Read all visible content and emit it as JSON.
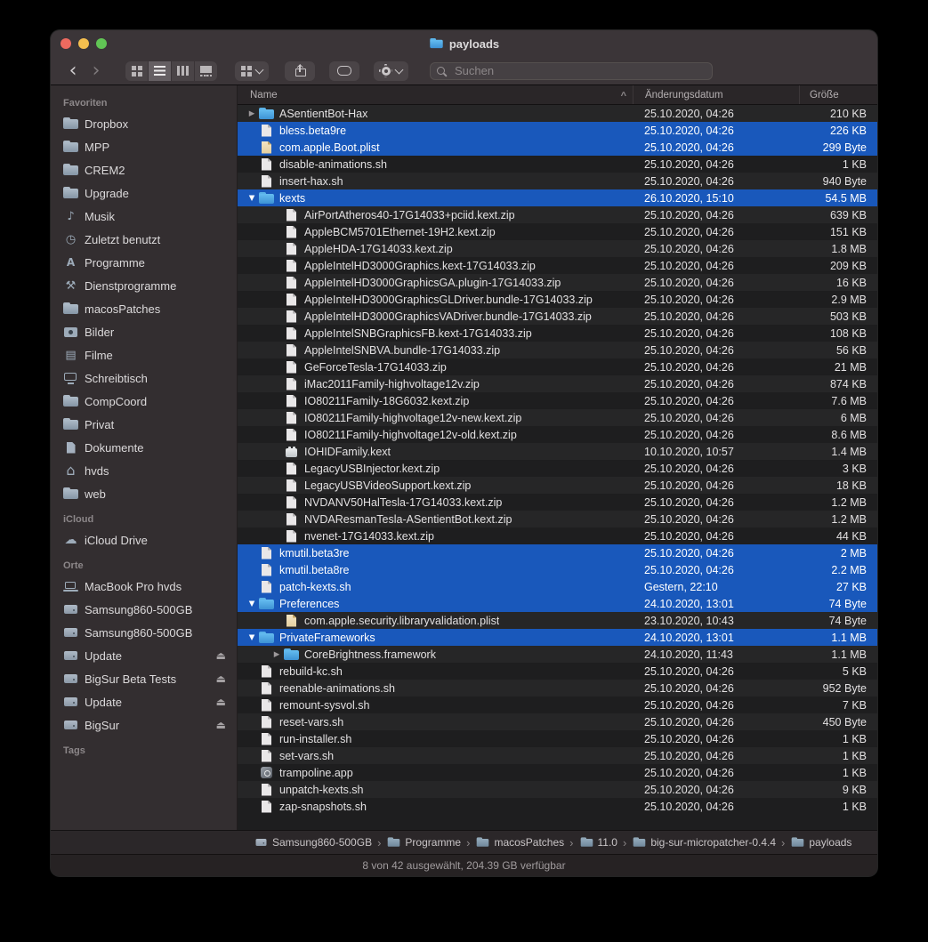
{
  "window": {
    "title": "payloads"
  },
  "toolbar": {
    "search_placeholder": "Suchen"
  },
  "colors": {
    "selection": "#1958bb",
    "traffic_red": "#ed6a5f",
    "traffic_yellow": "#f5bf4f",
    "traffic_green": "#61c555",
    "folder_blue": "#4aa3e0"
  },
  "icon_glyphs": {
    "back": "‹",
    "forward": "›",
    "sort_ascending": "^",
    "eject": "⏏",
    "disclosure_closed": "▶",
    "disclosure_open": "▼",
    "breadcrumb_separator": "›",
    "music": "♪",
    "clock": "◷",
    "applications": "A",
    "utilities": "⚒",
    "movies": "▤",
    "home": "⌂",
    "cloud": "☁"
  },
  "sidebar": {
    "sections": [
      {
        "title": "Favoriten",
        "items": [
          {
            "label": "Dropbox",
            "icon": "folder"
          },
          {
            "label": "MPP",
            "icon": "folder"
          },
          {
            "label": "CREM2",
            "icon": "folder"
          },
          {
            "label": "Upgrade",
            "icon": "folder"
          },
          {
            "label": "Musik",
            "icon": "music"
          },
          {
            "label": "Zuletzt benutzt",
            "icon": "clock"
          },
          {
            "label": "Programme",
            "icon": "applications"
          },
          {
            "label": "Dienstprogramme",
            "icon": "utilities"
          },
          {
            "label": "macosPatches",
            "icon": "folder"
          },
          {
            "label": "Bilder",
            "icon": "photos"
          },
          {
            "label": "Filme",
            "icon": "movies"
          },
          {
            "label": "Schreibtisch",
            "icon": "desktop"
          },
          {
            "label": "CompCoord",
            "icon": "folder"
          },
          {
            "label": "Privat",
            "icon": "folder"
          },
          {
            "label": "Dokumente",
            "icon": "documents"
          },
          {
            "label": "hvds",
            "icon": "home"
          },
          {
            "label": "web",
            "icon": "folder"
          }
        ]
      },
      {
        "title": "iCloud",
        "items": [
          {
            "label": "iCloud Drive",
            "icon": "cloud"
          }
        ]
      },
      {
        "title": "Orte",
        "items": [
          {
            "label": "MacBook Pro hvds",
            "icon": "laptop"
          },
          {
            "label": "Samsung860-500GB",
            "icon": "drive"
          },
          {
            "label": "Samsung860-500GB",
            "icon": "drive"
          },
          {
            "label": "Update",
            "icon": "drive",
            "eject": true
          },
          {
            "label": "BigSur Beta Tests",
            "icon": "drive",
            "eject": true
          },
          {
            "label": "Update",
            "icon": "drive",
            "eject": true
          },
          {
            "label": "BigSur",
            "icon": "drive",
            "eject": true
          }
        ]
      },
      {
        "title": "Tags",
        "items": []
      }
    ]
  },
  "list": {
    "columns": [
      "Name",
      "Änderungsdatum",
      "Größe"
    ],
    "sort_column": "Name",
    "rows": [
      {
        "name": "ASentientBot-Hax",
        "date": "25.10.2020, 04:26",
        "size": "210 KB",
        "icon": "folder",
        "level": 0,
        "disclosure": "closed",
        "selected": false
      },
      {
        "name": "bless.beta9re",
        "date": "25.10.2020, 04:26",
        "size": "226 KB",
        "icon": "document",
        "level": 0,
        "disclosure": "",
        "selected": true
      },
      {
        "name": "com.apple.Boot.plist",
        "date": "25.10.2020, 04:26",
        "size": "299 Byte",
        "icon": "plist",
        "level": 0,
        "disclosure": "",
        "selected": true
      },
      {
        "name": "disable-animations.sh",
        "date": "25.10.2020, 04:26",
        "size": "1 KB",
        "icon": "document",
        "level": 0,
        "disclosure": "",
        "selected": false
      },
      {
        "name": "insert-hax.sh",
        "date": "25.10.2020, 04:26",
        "size": "940 Byte",
        "icon": "document",
        "level": 0,
        "disclosure": "",
        "selected": false
      },
      {
        "name": "kexts",
        "date": "26.10.2020, 15:10",
        "size": "54.5 MB",
        "icon": "folder",
        "level": 0,
        "disclosure": "open",
        "selected": true
      },
      {
        "name": "AirPortAtheros40-17G14033+pciid.kext.zip",
        "date": "25.10.2020, 04:26",
        "size": "639 KB",
        "icon": "document",
        "level": 1,
        "disclosure": "",
        "selected": false
      },
      {
        "name": "AppleBCM5701Ethernet-19H2.kext.zip",
        "date": "25.10.2020, 04:26",
        "size": "151 KB",
        "icon": "document",
        "level": 1,
        "disclosure": "",
        "selected": false
      },
      {
        "name": "AppleHDA-17G14033.kext.zip",
        "date": "25.10.2020, 04:26",
        "size": "1.8 MB",
        "icon": "document",
        "level": 1,
        "disclosure": "",
        "selected": false
      },
      {
        "name": "AppleIntelHD3000Graphics.kext-17G14033.zip",
        "date": "25.10.2020, 04:26",
        "size": "209 KB",
        "icon": "document",
        "level": 1,
        "disclosure": "",
        "selected": false
      },
      {
        "name": "AppleIntelHD3000GraphicsGA.plugin-17G14033.zip",
        "date": "25.10.2020, 04:26",
        "size": "16 KB",
        "icon": "document",
        "level": 1,
        "disclosure": "",
        "selected": false
      },
      {
        "name": "AppleIntelHD3000GraphicsGLDriver.bundle-17G14033.zip",
        "date": "25.10.2020, 04:26",
        "size": "2.9 MB",
        "icon": "document",
        "level": 1,
        "disclosure": "",
        "selected": false
      },
      {
        "name": "AppleIntelHD3000GraphicsVADriver.bundle-17G14033.zip",
        "date": "25.10.2020, 04:26",
        "size": "503 KB",
        "icon": "document",
        "level": 1,
        "disclosure": "",
        "selected": false
      },
      {
        "name": "AppleIntelSNBGraphicsFB.kext-17G14033.zip",
        "date": "25.10.2020, 04:26",
        "size": "108 KB",
        "icon": "document",
        "level": 1,
        "disclosure": "",
        "selected": false
      },
      {
        "name": "AppleIntelSNBVA.bundle-17G14033.zip",
        "date": "25.10.2020, 04:26",
        "size": "56 KB",
        "icon": "document",
        "level": 1,
        "disclosure": "",
        "selected": false
      },
      {
        "name": "GeForceTesla-17G14033.zip",
        "date": "25.10.2020, 04:26",
        "size": "21 MB",
        "icon": "document",
        "level": 1,
        "disclosure": "",
        "selected": false
      },
      {
        "name": "iMac2011Family-highvoltage12v.zip",
        "date": "25.10.2020, 04:26",
        "size": "874 KB",
        "icon": "document",
        "level": 1,
        "disclosure": "",
        "selected": false
      },
      {
        "name": "IO80211Family-18G6032.kext.zip",
        "date": "25.10.2020, 04:26",
        "size": "7.6 MB",
        "icon": "document",
        "level": 1,
        "disclosure": "",
        "selected": false
      },
      {
        "name": "IO80211Family-highvoltage12v-new.kext.zip",
        "date": "25.10.2020, 04:26",
        "size": "6 MB",
        "icon": "document",
        "level": 1,
        "disclosure": "",
        "selected": false
      },
      {
        "name": "IO80211Family-highvoltage12v-old.kext.zip",
        "date": "25.10.2020, 04:26",
        "size": "8.6 MB",
        "icon": "document",
        "level": 1,
        "disclosure": "",
        "selected": false
      },
      {
        "name": "IOHIDFamily.kext",
        "date": "10.10.2020, 10:57",
        "size": "1.4 MB",
        "icon": "kext",
        "level": 1,
        "disclosure": "",
        "selected": false
      },
      {
        "name": "LegacyUSBInjector.kext.zip",
        "date": "25.10.2020, 04:26",
        "size": "3 KB",
        "icon": "document",
        "level": 1,
        "disclosure": "",
        "selected": false
      },
      {
        "name": "LegacyUSBVideoSupport.kext.zip",
        "date": "25.10.2020, 04:26",
        "size": "18 KB",
        "icon": "document",
        "level": 1,
        "disclosure": "",
        "selected": false
      },
      {
        "name": "NVDANV50HalTesla-17G14033.kext.zip",
        "date": "25.10.2020, 04:26",
        "size": "1.2 MB",
        "icon": "document",
        "level": 1,
        "disclosure": "",
        "selected": false
      },
      {
        "name": "NVDAResmanTesla-ASentientBot.kext.zip",
        "date": "25.10.2020, 04:26",
        "size": "1.2 MB",
        "icon": "document",
        "level": 1,
        "disclosure": "",
        "selected": false
      },
      {
        "name": "nvenet-17G14033.kext.zip",
        "date": "25.10.2020, 04:26",
        "size": "44 KB",
        "icon": "document",
        "level": 1,
        "disclosure": "",
        "selected": false
      },
      {
        "name": "kmutil.beta3re",
        "date": "25.10.2020, 04:26",
        "size": "2 MB",
        "icon": "document",
        "level": 0,
        "disclosure": "",
        "selected": true
      },
      {
        "name": "kmutil.beta8re",
        "date": "25.10.2020, 04:26",
        "size": "2.2 MB",
        "icon": "document",
        "level": 0,
        "disclosure": "",
        "selected": true
      },
      {
        "name": "patch-kexts.sh",
        "date": "Gestern, 22:10",
        "size": "27 KB",
        "icon": "document",
        "level": 0,
        "disclosure": "",
        "selected": true
      },
      {
        "name": "Preferences",
        "date": "24.10.2020, 13:01",
        "size": "74 Byte",
        "icon": "folder",
        "level": 0,
        "disclosure": "open",
        "selected": true
      },
      {
        "name": "com.apple.security.libraryvalidation.plist",
        "date": "23.10.2020, 10:43",
        "size": "74 Byte",
        "icon": "plist",
        "level": 1,
        "disclosure": "",
        "selected": false
      },
      {
        "name": "PrivateFrameworks",
        "date": "24.10.2020, 13:01",
        "size": "1.1 MB",
        "icon": "folder",
        "level": 0,
        "disclosure": "open",
        "selected": true
      },
      {
        "name": "CoreBrightness.framework",
        "date": "24.10.2020, 11:43",
        "size": "1.1 MB",
        "icon": "folder",
        "level": 1,
        "disclosure": "closed",
        "selected": false
      },
      {
        "name": "rebuild-kc.sh",
        "date": "25.10.2020, 04:26",
        "size": "5 KB",
        "icon": "document",
        "level": 0,
        "disclosure": "",
        "selected": false
      },
      {
        "name": "reenable-animations.sh",
        "date": "25.10.2020, 04:26",
        "size": "952 Byte",
        "icon": "document",
        "level": 0,
        "disclosure": "",
        "selected": false
      },
      {
        "name": "remount-sysvol.sh",
        "date": "25.10.2020, 04:26",
        "size": "7 KB",
        "icon": "document",
        "level": 0,
        "disclosure": "",
        "selected": false
      },
      {
        "name": "reset-vars.sh",
        "date": "25.10.2020, 04:26",
        "size": "450 Byte",
        "icon": "document",
        "level": 0,
        "disclosure": "",
        "selected": false
      },
      {
        "name": "run-installer.sh",
        "date": "25.10.2020, 04:26",
        "size": "1 KB",
        "icon": "document",
        "level": 0,
        "disclosure": "",
        "selected": false
      },
      {
        "name": "set-vars.sh",
        "date": "25.10.2020, 04:26",
        "size": "1 KB",
        "icon": "document",
        "level": 0,
        "disclosure": "",
        "selected": false
      },
      {
        "name": "trampoline.app",
        "date": "25.10.2020, 04:26",
        "size": "1 KB",
        "icon": "app",
        "level": 0,
        "disclosure": "",
        "selected": false
      },
      {
        "name": "unpatch-kexts.sh",
        "date": "25.10.2020, 04:26",
        "size": "9 KB",
        "icon": "document",
        "level": 0,
        "disclosure": "",
        "selected": false
      },
      {
        "name": "zap-snapshots.sh",
        "date": "25.10.2020, 04:26",
        "size": "1 KB",
        "icon": "document",
        "level": 0,
        "disclosure": "",
        "selected": false
      }
    ]
  },
  "pathbar": {
    "items": [
      {
        "label": "Samsung860-500GB",
        "icon": "drive"
      },
      {
        "label": "Programme",
        "icon": "folder"
      },
      {
        "label": "macosPatches",
        "icon": "folder"
      },
      {
        "label": "11.0",
        "icon": "folder"
      },
      {
        "label": "big-sur-micropatcher-0.4.4",
        "icon": "folder"
      },
      {
        "label": "payloads",
        "icon": "folder"
      }
    ]
  },
  "statusbar": {
    "text": "8 von 42 ausgewählt, 204.39 GB verfügbar"
  }
}
